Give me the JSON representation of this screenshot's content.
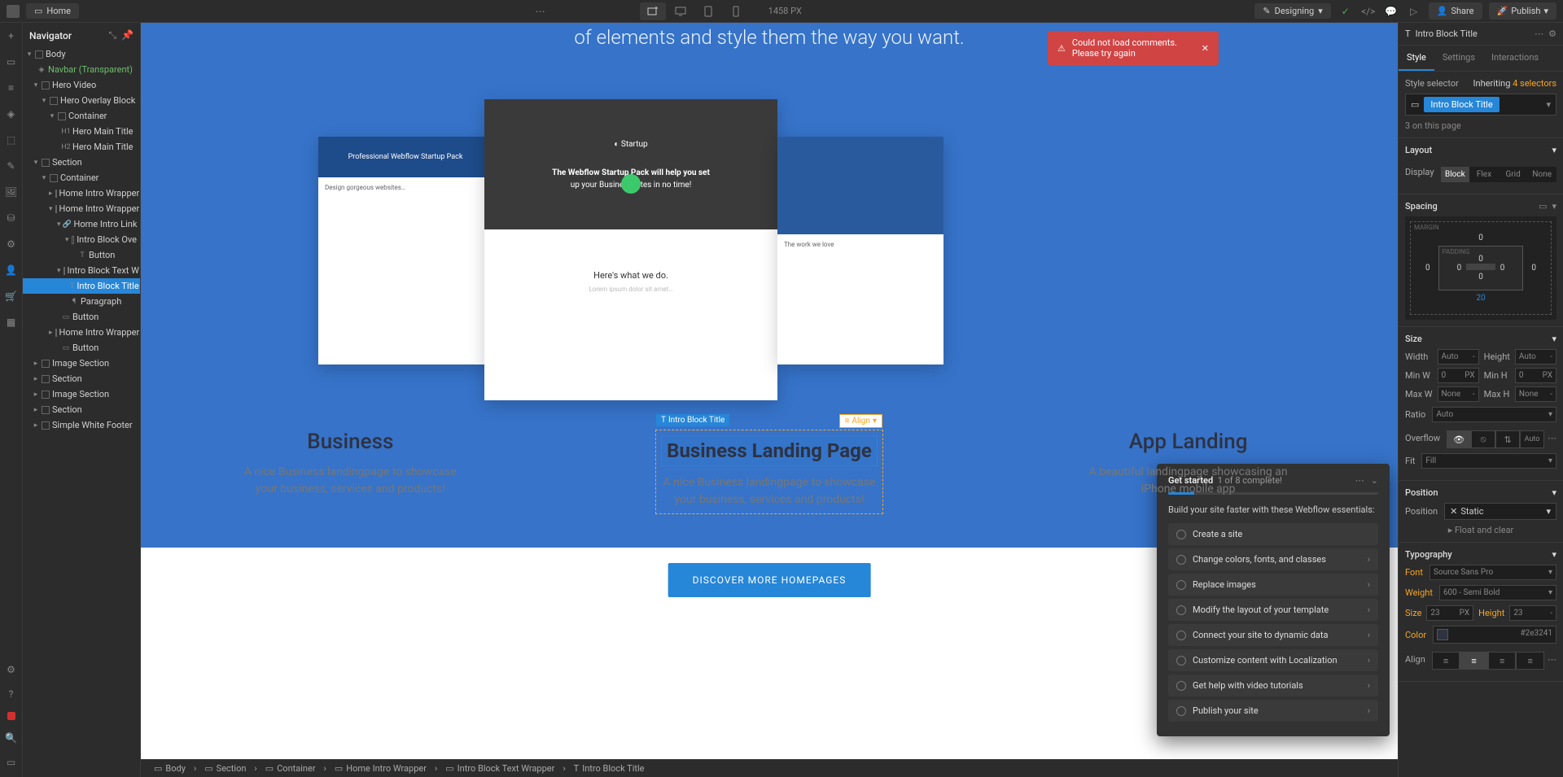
{
  "topbar": {
    "home": "Home",
    "width": "1458 PX",
    "designing": "Designing",
    "share": "Share",
    "publish": "Publish"
  },
  "navigator": {
    "title": "Navigator",
    "tree": {
      "body": "Body",
      "navbar": "Navbar (Transparent)",
      "hero_video": "Hero Video",
      "hero_overlay": "Hero Overlay Block",
      "container1": "Container",
      "h1": "Hero Main Title",
      "h2": "Hero Main Title",
      "section1": "Section",
      "container2": "Container",
      "wrap1": "Home Intro Wrapper",
      "wrap2": "Home Intro Wrapper",
      "linkb": "Home Intro Link B",
      "ove": "Intro Block Ove",
      "button1": "Button",
      "textw": "Intro Block Text W",
      "title": "Intro Block Title",
      "para": "Paragraph",
      "button2": "Button",
      "wrap3": "Home Intro Wrapper",
      "button3": "Button",
      "imgsec1": "Image Section",
      "section2": "Section",
      "imgsec2": "Image Section",
      "section3": "Section",
      "footer": "Simple White Footer"
    }
  },
  "canvas": {
    "headline": "of elements and style them the way you want.",
    "col1_title": "Business",
    "col1_desc": "A nice Business landingpage to showcase your business, services and products!",
    "col2_label": "Intro Block Title",
    "col2_align": "Align",
    "col2_title": "Business Landing Page",
    "col2_desc": "A nice Business landingpage to showcase your business, services and products!",
    "col3_title": "App Landing",
    "col3_desc": "A beautiful landingpage showcasing an iPhone mobile app",
    "cta": "DISCOVER MORE HOMEPAGES",
    "tpl_center_hero1": "The Webflow Startup Pack will help you set",
    "tpl_center_hero2": "up your Business sites in no time!",
    "tpl_center_body": "Here's what we do."
  },
  "toast": {
    "msg": "Could not load comments. Please try again"
  },
  "getstarted": {
    "title": "Get started",
    "progress": "1 of 8 complete!",
    "sub": "Build your site faster with these Webflow essentials:",
    "items": [
      "Create a site",
      "Change colors, fonts, and classes",
      "Replace images",
      "Modify the layout of your template",
      "Connect your site to dynamic data",
      "Customize content with Localization",
      "Get help with video tutorials",
      "Publish your site"
    ]
  },
  "breadcrumb": [
    "Body",
    "Section",
    "Container",
    "Home Intro Wrapper",
    "Intro Block Text Wrapper",
    "Intro Block Title"
  ],
  "rp": {
    "head": "Intro Block Title",
    "tabs": {
      "style": "Style",
      "settings": "Settings",
      "interactions": "Interactions"
    },
    "selector_label": "Style selector",
    "inheriting": "Inheriting",
    "inherit_count": "4 selectors",
    "selector_value": "Intro Block Title",
    "on_page": "3 on this page",
    "layout": "Layout",
    "display": "Display",
    "disp_opts": {
      "block": "Block",
      "flex": "Flex",
      "grid": "Grid",
      "none": "None"
    },
    "spacing": "Spacing",
    "margin_label": "MARGIN",
    "padding_label": "PADDING",
    "sp": {
      "m_t": "0",
      "m_l": "0",
      "m_r": "0",
      "m_b": "20",
      "p_t": "0",
      "p_l": "0",
      "p_r": "0",
      "p_b": "0",
      "pad_mid_l": "0",
      "pad_mid_r": "0"
    },
    "size": "Size",
    "width": "Width",
    "height": "Height",
    "minw": "Min W",
    "minh": "Min H",
    "maxw": "Max W",
    "maxh": "Max H",
    "auto": "Auto",
    "none_v": "None",
    "zero": "0",
    "px": "PX",
    "dash": "-",
    "ratio": "Ratio",
    "ratio_v": "Auto",
    "overflow": "Overflow",
    "of_auto": "Auto",
    "fit": "Fit",
    "fit_v": "Fill",
    "position": "Position",
    "pos_label": "Position",
    "pos_v": "Static",
    "float": "Float and clear",
    "typo": "Typography",
    "font": "Font",
    "font_v": "Source Sans Pro",
    "weight": "Weight",
    "weight_v": "600 - Semi Bold",
    "tsize": "Size",
    "tsize_v": "23",
    "theight": "Height",
    "theight_v": "23",
    "color": "Color",
    "color_v": "#2e3241",
    "align": "Align"
  }
}
